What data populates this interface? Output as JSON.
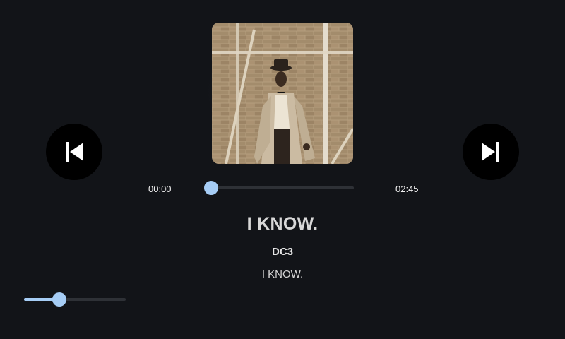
{
  "track": {
    "title": "I KNOW.",
    "artist": "DC3",
    "album": "I KNOW."
  },
  "playback": {
    "current_time": "00:00",
    "total_time": "02:45",
    "progress": 0.0
  },
  "volume": {
    "level": 0.35
  },
  "controls": {
    "prev_icon": "skip-previous-icon",
    "next_icon": "skip-next-icon"
  },
  "colors": {
    "accent": "#a6cdf5",
    "background": "#121418",
    "button_bg": "#000000"
  }
}
